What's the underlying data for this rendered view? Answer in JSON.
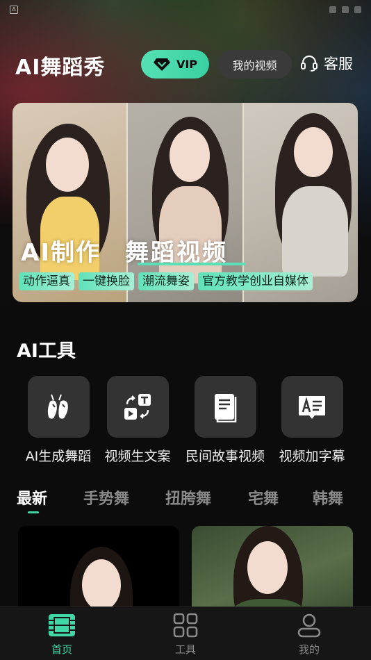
{
  "status_bar": {
    "badge": "A"
  },
  "header": {
    "title": "AI舞蹈秀",
    "vip_label": "VIP",
    "my_videos_label": "我的视频",
    "service_label": "客服"
  },
  "banner": {
    "headline_left": "AI制作",
    "headline_right": "舞蹈视频",
    "tags": [
      "动作逼真",
      "一键换脸",
      "潮流舞姿",
      "官方教学创业自媒体"
    ]
  },
  "tools_section": {
    "title": "AI工具",
    "items": [
      {
        "label": "AI生成舞蹈",
        "icon": "ballet-shoes-icon"
      },
      {
        "label": "视频生文案",
        "icon": "video-to-text-icon"
      },
      {
        "label": "民间故事视频",
        "icon": "book-icon"
      },
      {
        "label": "视频加字幕",
        "icon": "subtitle-icon"
      }
    ]
  },
  "category_tabs": {
    "items": [
      "最新",
      "手势舞",
      "扭胯舞",
      "宅舞",
      "韩舞"
    ],
    "active_index": 0
  },
  "bottom_nav": {
    "items": [
      {
        "label": "首页",
        "icon": "film-icon",
        "active": true
      },
      {
        "label": "工具",
        "icon": "grid-icon",
        "active": false
      },
      {
        "label": "我的",
        "icon": "user-icon",
        "active": false
      }
    ]
  },
  "colors": {
    "accent": "#41d6a5",
    "background": "#0c0c0c",
    "tool_tile": "#333333",
    "nav_background": "#161616"
  }
}
